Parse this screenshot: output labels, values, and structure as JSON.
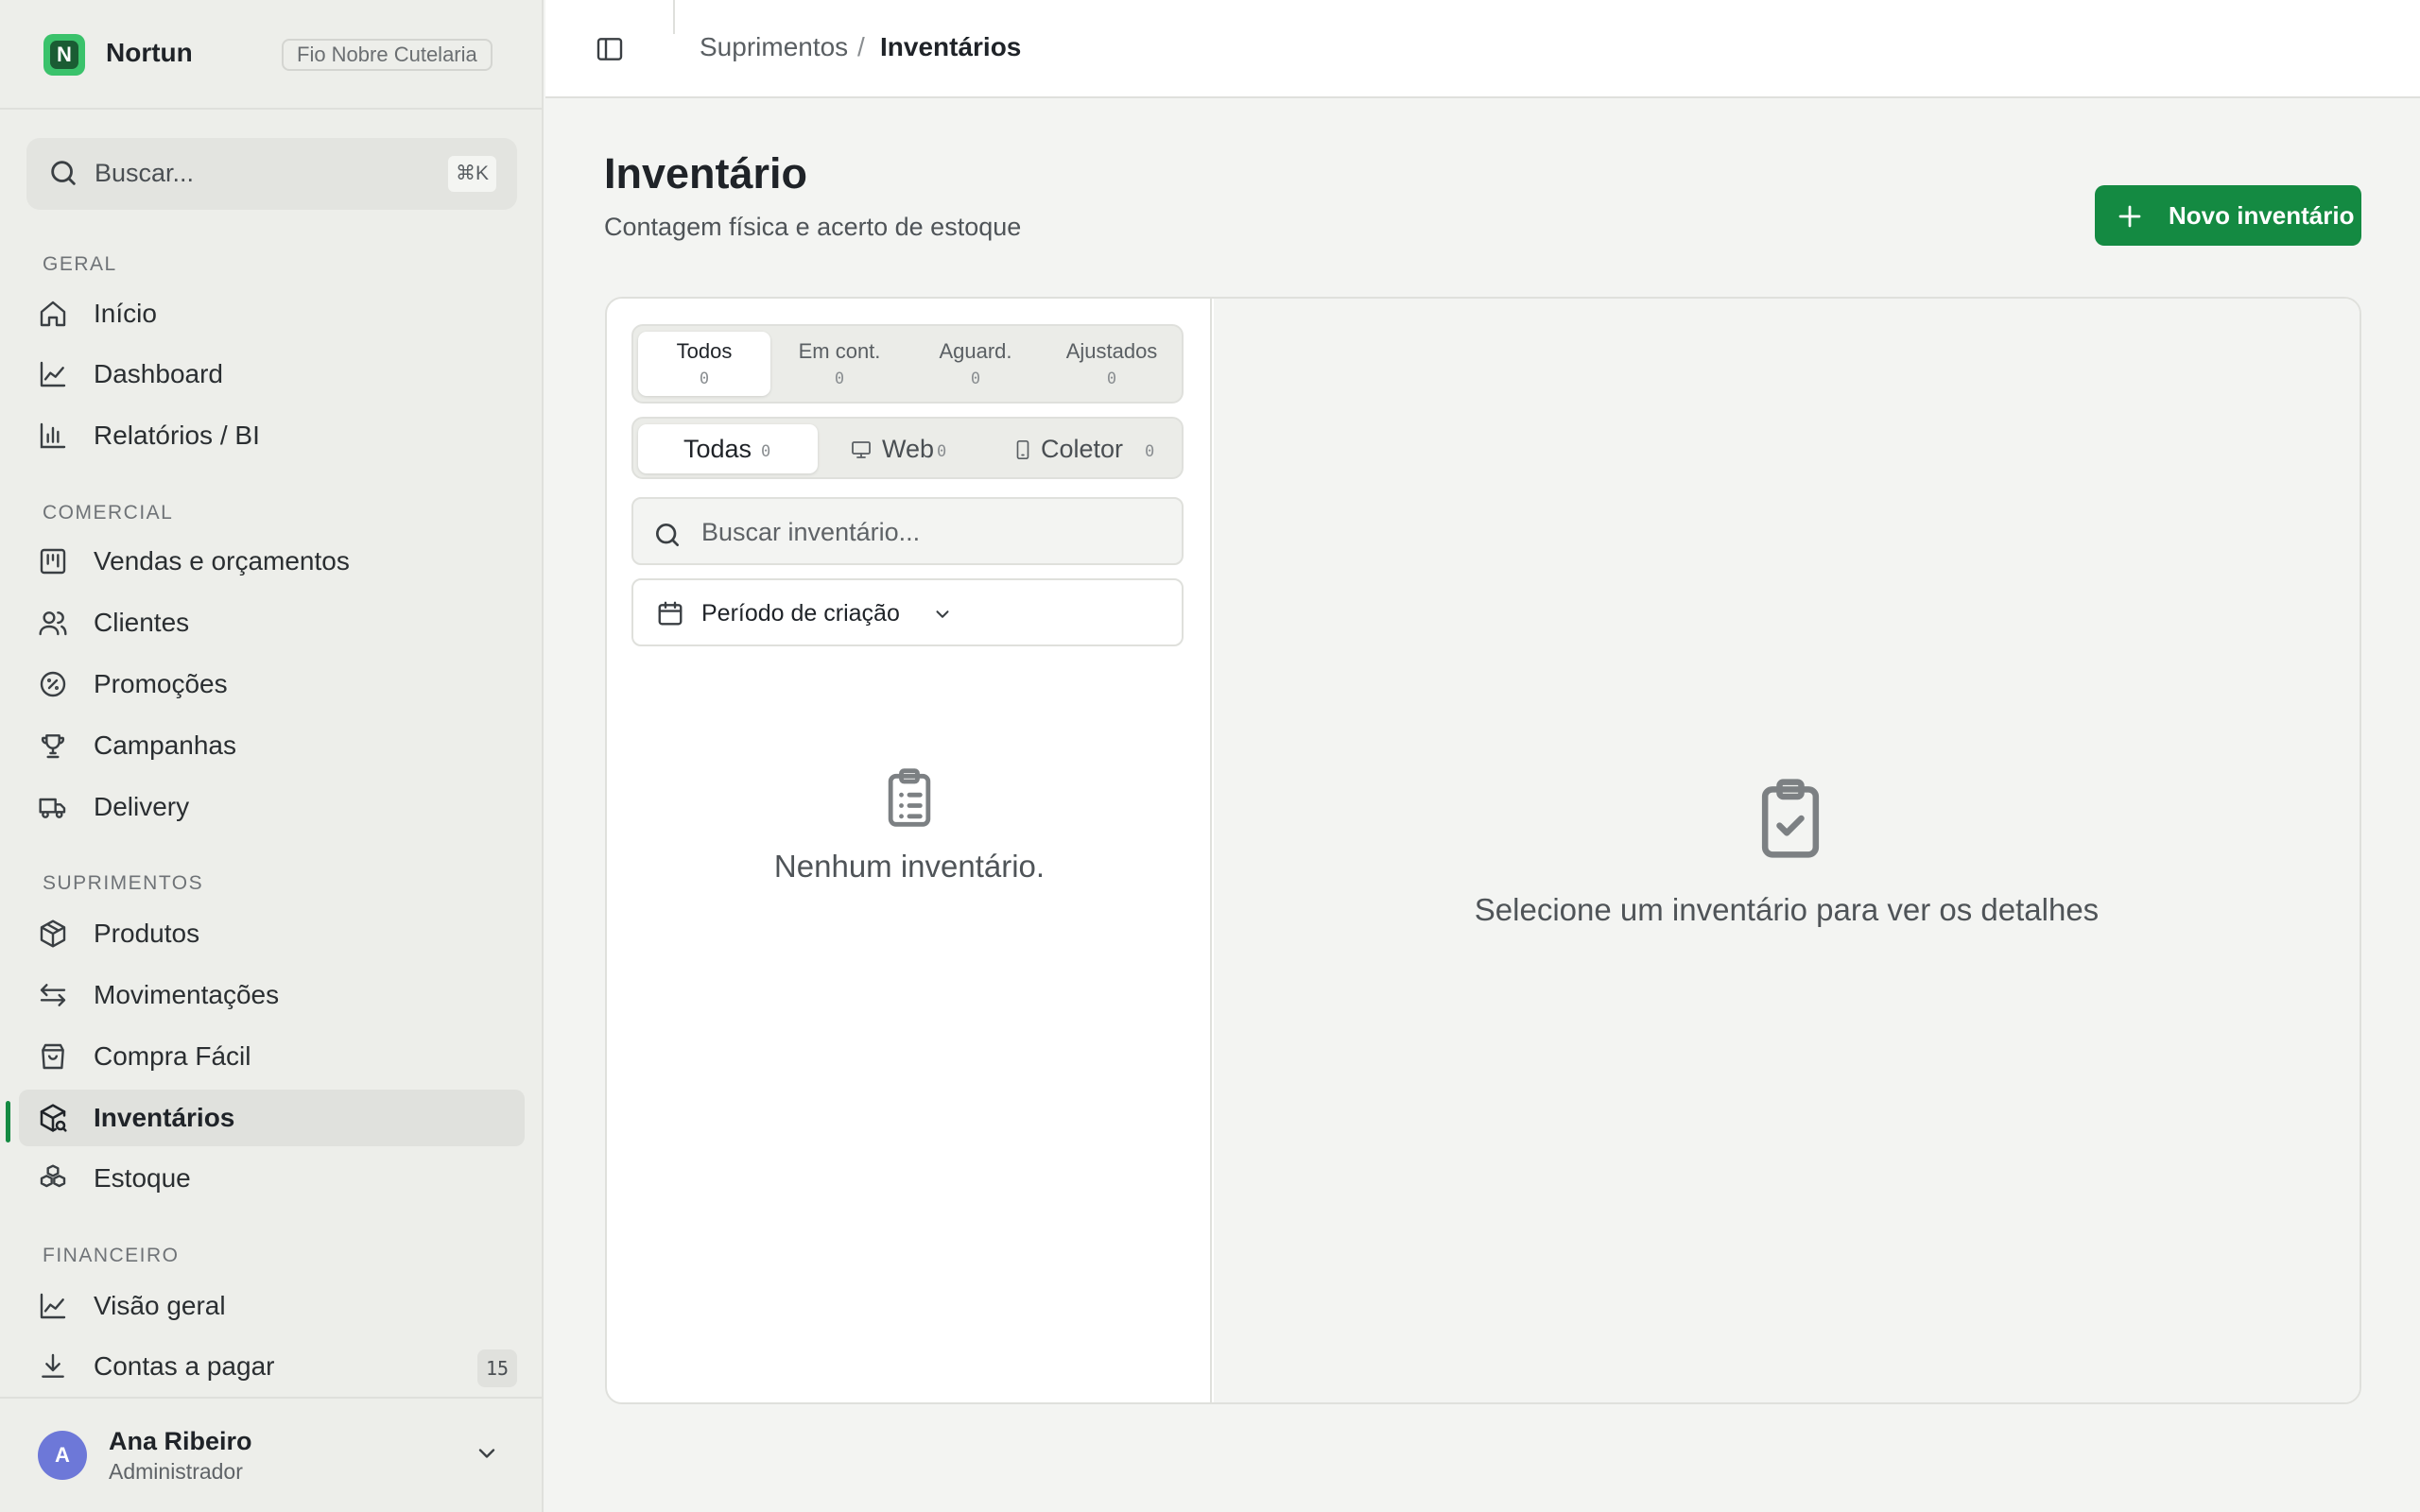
{
  "brand": {
    "name": "Nortun",
    "logo_letter": "N",
    "company": "Fio Nobre Cutelaria"
  },
  "search": {
    "placeholder": "Buscar...",
    "shortcut": "⌘K"
  },
  "sidebar": {
    "sections": [
      {
        "title": "GERAL",
        "items": [
          {
            "label": "Início",
            "icon": "home-icon"
          },
          {
            "label": "Dashboard",
            "icon": "line-chart-icon"
          },
          {
            "label": "Relatórios / BI",
            "icon": "bar-chart-icon"
          }
        ]
      },
      {
        "title": "COMERCIAL",
        "items": [
          {
            "label": "Vendas e orçamentos",
            "icon": "kanban-icon"
          },
          {
            "label": "Clientes",
            "icon": "users-icon"
          },
          {
            "label": "Promoções",
            "icon": "percent-badge-icon"
          },
          {
            "label": "Campanhas",
            "icon": "trophy-icon"
          },
          {
            "label": "Delivery",
            "icon": "truck-icon"
          }
        ]
      },
      {
        "title": "SUPRIMENTOS",
        "items": [
          {
            "label": "Produtos",
            "icon": "package-icon"
          },
          {
            "label": "Movimentações",
            "icon": "arrows-left-right-icon"
          },
          {
            "label": "Compra Fácil",
            "icon": "shopping-bag-icon"
          },
          {
            "label": "Inventários",
            "icon": "package-search-icon",
            "active": true
          },
          {
            "label": "Estoque",
            "icon": "boxes-icon"
          }
        ]
      },
      {
        "title": "FINANCEIRO",
        "items": [
          {
            "label": "Visão geral",
            "icon": "line-chart-icon"
          },
          {
            "label": "Contas a pagar",
            "icon": "download-icon",
            "badge": "15"
          }
        ]
      }
    ]
  },
  "user": {
    "initial": "A",
    "name": "Ana Ribeiro",
    "role": "Administrador"
  },
  "breadcrumb": {
    "parent": "Suprimentos",
    "separator": "/",
    "current": "Inventários"
  },
  "page": {
    "title": "Inventário",
    "subtitle": "Contagem física e acerto de estoque",
    "new_button": "Novo inventário"
  },
  "status_tabs": [
    {
      "label": "Todos",
      "count": "0",
      "active": true
    },
    {
      "label": "Em cont.",
      "count": "0"
    },
    {
      "label": "Aguard.",
      "count": "0"
    },
    {
      "label": "Ajustados",
      "count": "0"
    }
  ],
  "origin_tabs": [
    {
      "label": "Todas",
      "count": "0",
      "active": true
    },
    {
      "label": "Web",
      "count": "0",
      "icon": "monitor-icon"
    },
    {
      "label": "Coletor",
      "count": "0",
      "icon": "smartphone-icon"
    }
  ],
  "list": {
    "search_placeholder": "Buscar inventário...",
    "period_filter": "Período de criação",
    "empty_text": "Nenhum inventário."
  },
  "detail": {
    "empty_text": "Selecione um inventário para ver os detalhes"
  },
  "colors": {
    "accent": "#148a42",
    "logo": "#3ac26b",
    "avatar": "#6d78d8",
    "sidebar_bg": "#edeeea"
  }
}
